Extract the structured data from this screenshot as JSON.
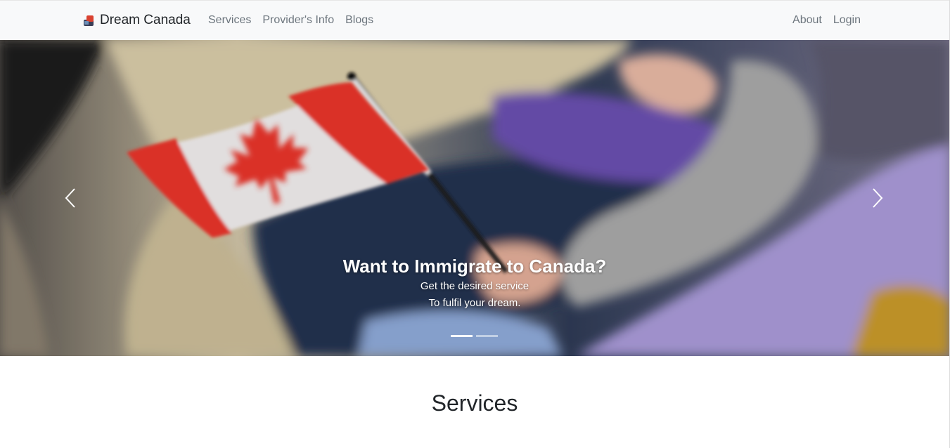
{
  "navbar": {
    "brand": "Dream Canada",
    "left_links": [
      "Services",
      "Provider's Info",
      "Blogs"
    ],
    "right_links": [
      "About",
      "Login"
    ]
  },
  "carousel": {
    "caption_title": "Want to Immigrate to Canada?",
    "caption_line1": "Get the desired service",
    "caption_line2": "To fulfil your dream.",
    "slide_count": 2,
    "active_slide": 1
  },
  "section": {
    "title": "Services"
  },
  "colors": {
    "navbar_bg": "#f8f9fa",
    "link": "#6c757d",
    "flag_red": "#e8362a"
  },
  "icons": [
    "brand-logo-icon",
    "chevron-left-icon",
    "chevron-right-icon",
    "maple-leaf-icon"
  ]
}
